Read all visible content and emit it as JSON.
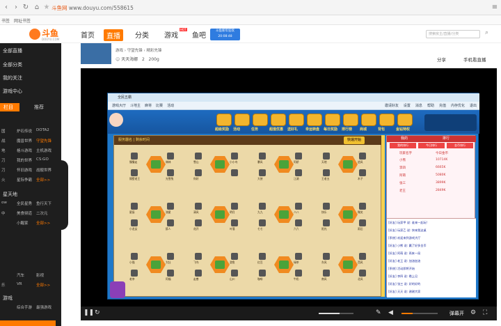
{
  "browser": {
    "url_site": "斗鱼网",
    "url_path": "www.douyu.com/558615",
    "bookmarks": [
      "书签",
      "网址书签"
    ]
  },
  "header": {
    "logo_text": "斗鱼",
    "logo_sub": "DOUYU.COM",
    "nav": [
      "首页",
      "直播",
      "分类",
      "游戏",
      "鱼吧"
    ],
    "hot_badge": "HOT",
    "promo": [
      "斗鱼新年狂欢",
      "20",
      "08",
      "48"
    ],
    "search_placeholder": "搜索房主/直播/分类"
  },
  "sidebar": {
    "menu": [
      "全部直播",
      "全部分类",
      "我的关注",
      "游戏中心"
    ],
    "tabs": [
      "栏目",
      "推荐"
    ],
    "rows": [
      [
        "国",
        "炉石传说",
        "DOTA2"
      ],
      [
        "战",
        "魔兽世界",
        "守望先锋"
      ],
      [
        "地",
        "格斗游戏",
        "主机游戏"
      ],
      [
        "刀",
        "我的世界",
        "CS:GO"
      ],
      [
        "刀",
        "怀旧游戏",
        "战舰世界"
      ],
      [
        "火",
        "星际争霸",
        "全部>>"
      ]
    ],
    "section2": "星天地",
    "rows2": [
      [
        "ow",
        "全民星秀",
        "鱼行天下"
      ],
      [
        "中",
        "美食频道",
        "二次元"
      ],
      [
        "",
        "小醒家",
        "全部>>"
      ]
    ],
    "rows3": [
      [
        "",
        "汽车",
        "影视"
      ],
      [
        "乐",
        "VR",
        "全部>>"
      ]
    ],
    "section3": "游戏",
    "rows4": [
      [
        "",
        "综合手游",
        "最强游戏"
      ]
    ]
  },
  "meta": {
    "breadcrumb": [
      "游戏",
      "守望先锋",
      "精彩先锋"
    ],
    "streamer": "天天海娜",
    "stats": [
      "2",
      "200g"
    ],
    "share": "分享",
    "mobile": "手机看直播"
  },
  "game": {
    "window_title": "全民五霸",
    "toolbar": [
      "游戏大厅",
      "斗地主",
      "麻将",
      "比赛",
      "活动"
    ],
    "toolbar_right": [
      "邀请好友",
      "设置",
      "消息",
      "帮助",
      "充值",
      "内存优化",
      "退出"
    ],
    "banner_icons": [
      "超级奖励",
      "活动",
      "任务",
      "超值优惠",
      "送好礼",
      "幸运转盘",
      "每日奖励",
      "排行榜",
      "商城",
      "背包",
      "金钻特权"
    ],
    "lobby_title": "服务器名 | 剩余时间",
    "quick_start": "快速开始",
    "tables": [
      {
        "names": [
          "慢慢走",
          "林林",
          "隔壁老王",
          "光雪兔"
        ]
      },
      {
        "names": [
          "雪山",
          "小小鸟",
          "你好",
          ""
        ]
      },
      {
        "names": [
          "暴风",
          "阿娇",
          "大侠",
          "江湖"
        ]
      },
      {
        "names": [
          "天地",
          "追风",
          "王老五",
          "木子"
        ]
      },
      {
        "names": [
          "星辰",
          "流星",
          "小龙女",
          "醉人"
        ]
      },
      {
        "names": [
          "清风",
          "明月",
          "花开",
          "叶落"
        ]
      },
      {
        "names": [
          "九九",
          "八八",
          "七七",
          "六六"
        ]
      },
      {
        "names": [
          "快乐",
          "微笑",
          "阳光",
          "雨后"
        ]
      },
      {
        "names": [
          "小强",
          "大壮",
          "老李",
          "阿福"
        ]
      },
      {
        "names": [
          "飞鸟",
          "游鱼",
          "走兽",
          "山川"
        ]
      },
      {
        "names": [
          "红豆",
          "绿茶",
          "咖啡",
          "牛奶"
        ]
      },
      {
        "names": [
          "东风",
          "西风",
          "南风",
          "北风"
        ]
      }
    ],
    "panel_tabs": [
      "我的",
      "排行"
    ],
    "panel_sub": [
      "我的排行",
      "今日排行",
      "金币排行"
    ],
    "panel_head": [
      "玩家名字",
      "今日金币"
    ],
    "panel_rows": [
      [
        "小熊",
        "10714K"
      ],
      [
        "李四",
        "6665K"
      ],
      [
        "阿萌",
        "5080K"
      ],
      [
        "张三",
        "3899K"
      ],
      [
        "老王",
        "2849K"
      ]
    ],
    "chat": [
      "[好友] 玩家甲 说: 谁来一起玩!",
      "[好友] 玩家乙 说: 快来我这桌",
      "[系统] 欢迎来到游戏大厅",
      "[好友] 小熊 说: 赢了好多金币",
      "[好友] 阿萌 说: 再来一局",
      "[好友] 老王 说: 加油加油",
      "[系统] 活动即将开始",
      "[好友] 李四 说: 晚上见",
      "[好友] 张三 说: 好的好的",
      "[好友] 天天 说: 谢谢大家"
    ]
  },
  "controls": {
    "barrage": "弹幕开",
    "progress": 0.3
  }
}
